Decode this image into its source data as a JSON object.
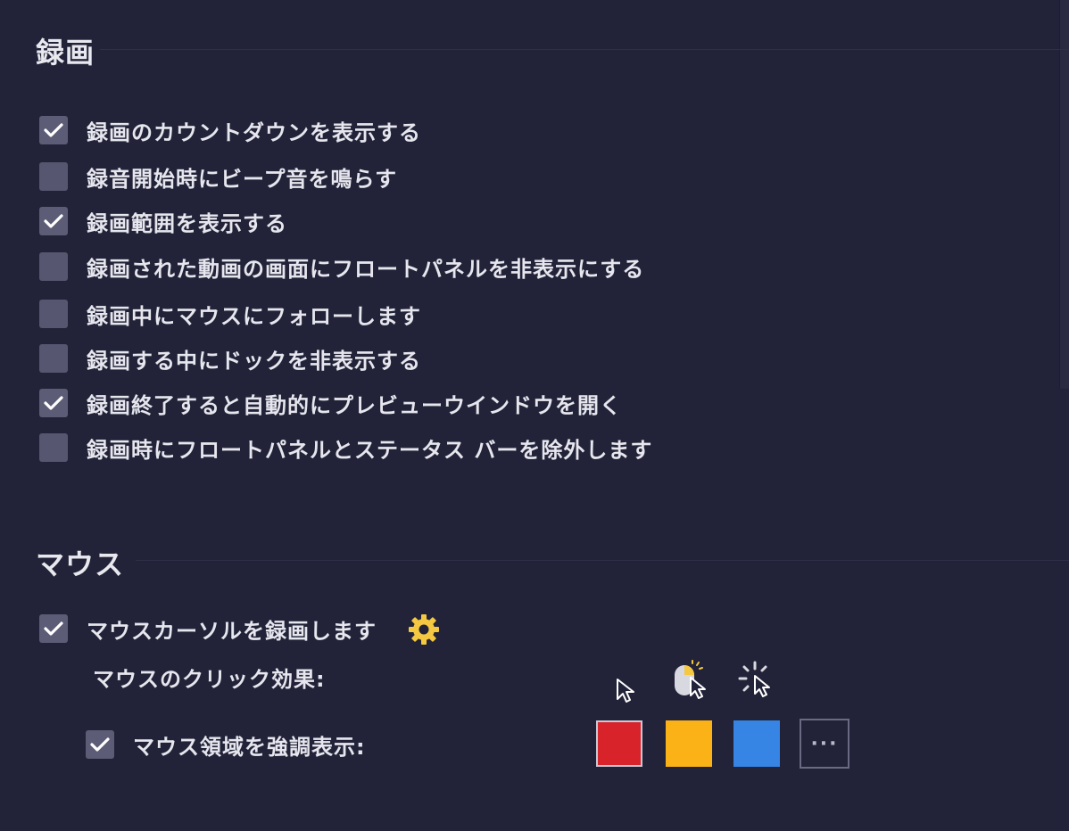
{
  "recording": {
    "title": "録画",
    "options": [
      {
        "label": "録画のカウントダウンを表示する",
        "checked": true
      },
      {
        "label": "録音開始時にビープ音を鳴らす",
        "checked": false
      },
      {
        "label": "録画範囲を表示する",
        "checked": true
      },
      {
        "label": "録画された動画の画面にフロートパネルを非表示にする",
        "checked": false
      },
      {
        "label": "録画中にマウスにフォローします",
        "checked": false
      },
      {
        "label": "録画する中にドックを非表示する",
        "checked": false
      },
      {
        "label": "録画終了すると自動的にプレビューウインドウを開く",
        "checked": true
      },
      {
        "label": "録画時にフロートパネルとステータス バーを除外します",
        "checked": false
      }
    ]
  },
  "mouse": {
    "title": "マウス",
    "record_cursor": {
      "label": "マウスカーソルを録画します",
      "checked": true
    },
    "click_effect_label": "マウスのクリック効果:",
    "click_effects": [
      "cursor-plain-icon",
      "cursor-mouse-click-icon",
      "cursor-burst-icon"
    ],
    "highlight": {
      "label": "マウス領域を強調表示:",
      "checked": true
    },
    "highlight_colors": [
      "#d9232b",
      "#fbb216",
      "#3684e3"
    ],
    "more_colors_label": "···"
  }
}
